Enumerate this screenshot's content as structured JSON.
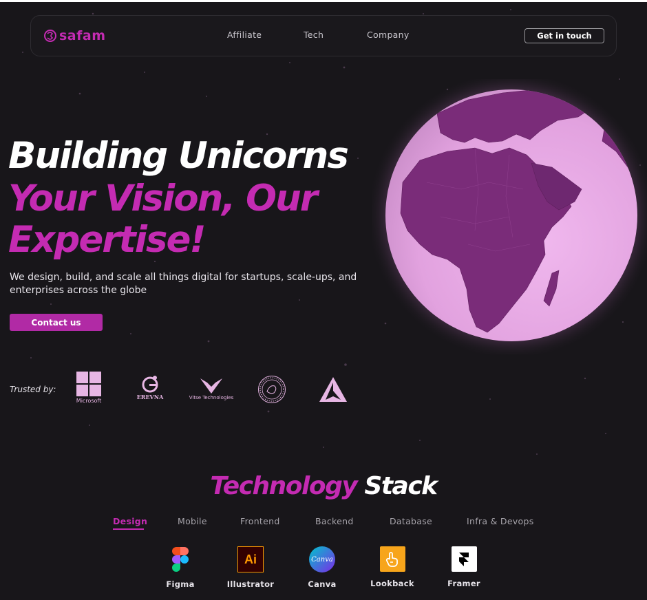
{
  "brand": {
    "name": "safam",
    "accent": "#c42bb2",
    "background": "#18161a"
  },
  "nav": {
    "links": [
      "Affiliate",
      "Tech",
      "Company"
    ],
    "cta": "Get in touch"
  },
  "hero": {
    "line1": "Building Unicorns",
    "line2": "Your Vision, Our",
    "line3": "Expertise!",
    "subtitle": "We design, build, and scale all things digital for startups, scale-ups, and enterprises across the globe",
    "button": "Contact us"
  },
  "trusted": {
    "label": "Trusted by:",
    "logos": [
      {
        "name": "Microsoft",
        "icon": "microsoft-logo"
      },
      {
        "name": "EREVNA",
        "icon": "erevna-logo"
      },
      {
        "name": "Vitse Technologies",
        "icon": "vitse-logo"
      },
      {
        "name": "",
        "icon": "seal-logo"
      },
      {
        "name": "",
        "icon": "triangle-logo"
      }
    ]
  },
  "stack": {
    "title_pink": "Technology",
    "title_white": "Stack",
    "tabs": [
      "Design",
      "Mobile",
      "Frontend",
      "Backend",
      "Database",
      "Infra & Devops"
    ],
    "active_tab": "Design",
    "tools": [
      {
        "name": "Figma",
        "icon": "figma-icon"
      },
      {
        "name": "Illustrator",
        "icon": "illustrator-icon"
      },
      {
        "name": "Canva",
        "icon": "canva-icon"
      },
      {
        "name": "Lookback",
        "icon": "lookback-icon"
      },
      {
        "name": "Framer",
        "icon": "framer-icon"
      }
    ]
  },
  "icon_text": {
    "illustrator": "Ai",
    "canva": "Canva"
  }
}
